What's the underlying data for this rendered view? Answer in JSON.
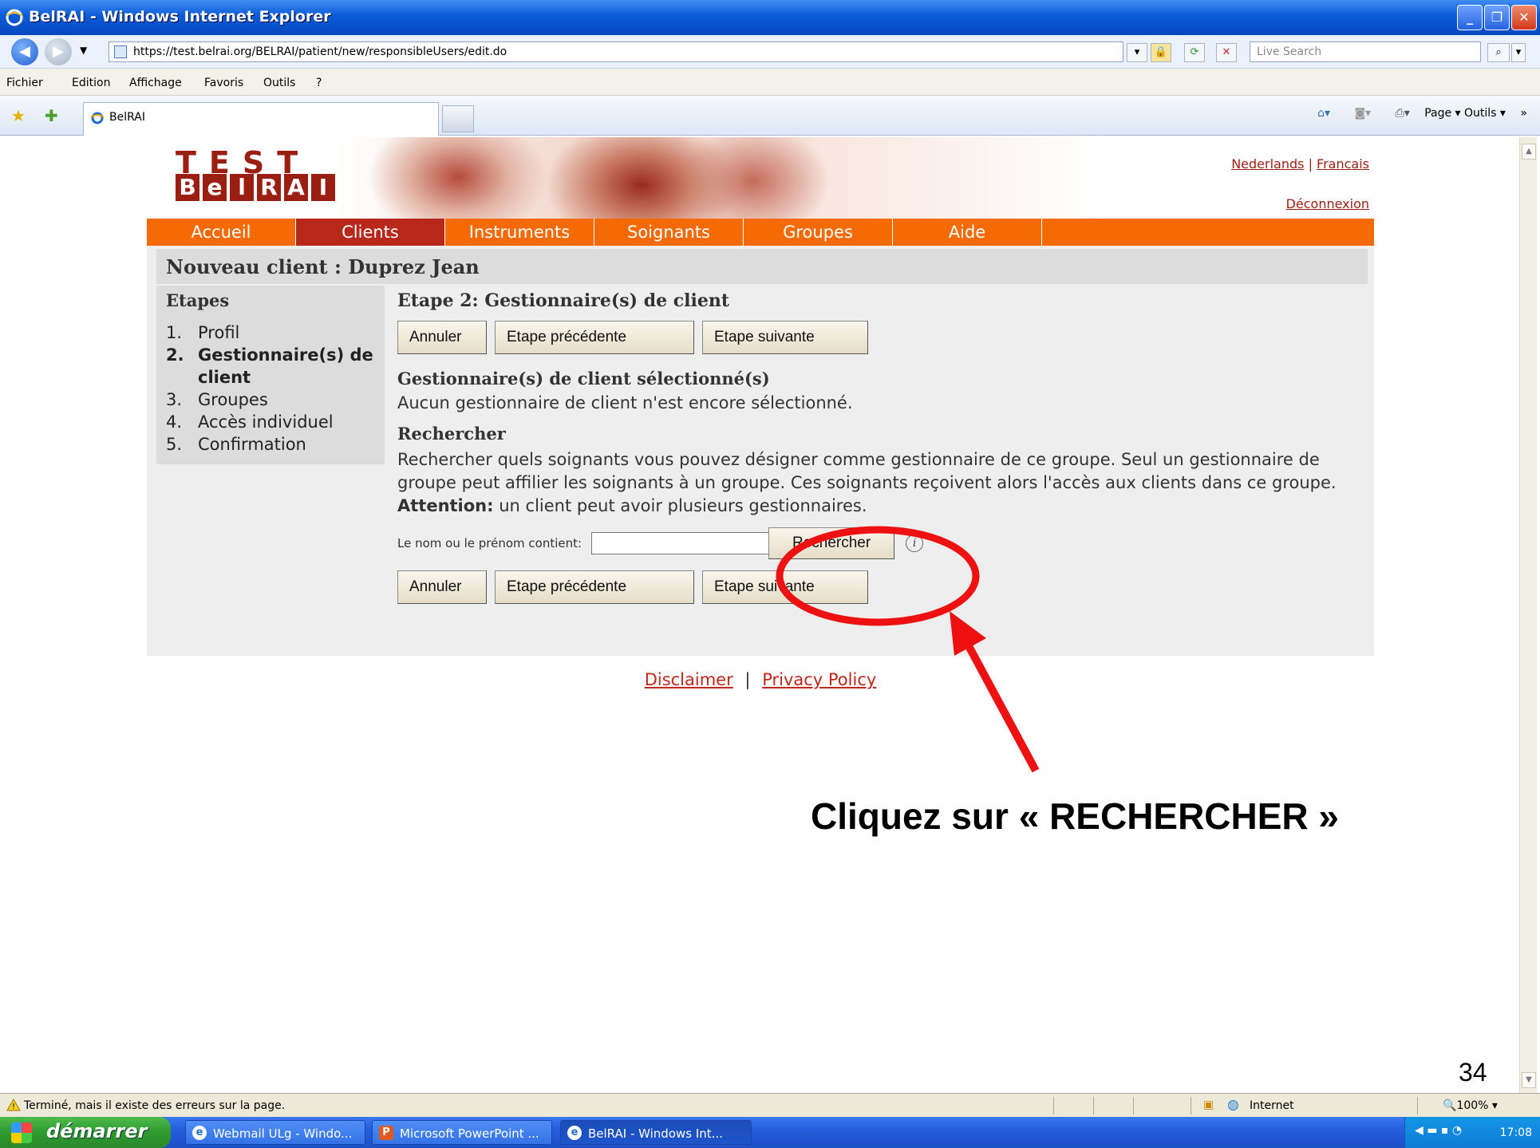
{
  "window": {
    "title": "BelRAI - Windows Internet Explorer",
    "minimize": "_",
    "maximize": "❐",
    "close": "✕"
  },
  "address": {
    "url": "https://test.belrai.org/BELRAI/patient/new/responsibleUsers/edit.do",
    "search_placeholder": "Live Search"
  },
  "menu": [
    "Fichier",
    "Edition",
    "Affichage",
    "Favoris",
    "Outils",
    "?"
  ],
  "tabs": {
    "active_label": "BelRAI",
    "command_bar": "Page ▾   Outils ▾"
  },
  "site": {
    "logo_top": "TEST",
    "logo_letters": [
      "B",
      "e",
      "l",
      "R",
      "A",
      "I"
    ],
    "lang": {
      "nl": "Nederlands",
      "sep": "|",
      "fr": "Francais"
    },
    "logout": "Déconnexion",
    "nav": [
      "Accueil",
      "Clients",
      "Instruments",
      "Soignants",
      "Groupes",
      "Aide"
    ],
    "active_nav": "Clients"
  },
  "page": {
    "client_title": "Nouveau client : Duprez Jean",
    "steps_title": "Etapes",
    "steps": [
      {
        "num": "1.",
        "label": "Profil"
      },
      {
        "num": "2.",
        "label": "Gestionnaire(s) de client"
      },
      {
        "num": "3.",
        "label": "Groupes"
      },
      {
        "num": "4.",
        "label": "Accès individuel"
      },
      {
        "num": "5.",
        "label": "Confirmation"
      }
    ],
    "step_heading": "Etape 2: Gestionnaire(s) de client",
    "buttons": {
      "cancel": "Annuler",
      "prev": "Etape précédente",
      "next": "Etape suivante"
    },
    "selected_heading": "Gestionnaire(s) de client sélectionné(s)",
    "selected_text": "Aucun gestionnaire de client n'est encore sélectionné.",
    "search_heading": "Rechercher",
    "search_desc_1": "Rechercher quels soignants vous pouvez désigner comme gestionnaire de ce groupe. Seul un gestionnaire de groupe peut affilier les soignants à un groupe. Ces soignants reçoivent alors l'accès aux clients dans ce groupe.",
    "search_desc_bold": "Attention:",
    "search_desc_2": "un client peut avoir plusieurs gestionnaires.",
    "search_label": "Le nom ou le prénom contient:",
    "search_value": "",
    "search_button": "Rechercher",
    "info_icon": "i"
  },
  "footer": {
    "disclaimer": "Disclaimer",
    "sep": "|",
    "privacy": "Privacy Policy"
  },
  "annotation": {
    "caption": "Cliquez sur « RECHERCHER »",
    "slide_number": "34",
    "color": "#ee1111"
  },
  "status": {
    "text": "Terminé, mais il existe des erreurs sur la page.",
    "zone": "Internet",
    "zoom": "100%"
  },
  "taskbar": {
    "start": "démarrer",
    "tasks": [
      {
        "label": "Webmail ULg - Windo...",
        "icon": "e"
      },
      {
        "label": "Microsoft PowerPoint ...",
        "icon": "P"
      },
      {
        "label": "BelRAI - Windows Int...",
        "icon": "e"
      }
    ],
    "clock": "17:08"
  },
  "colors": {
    "brand_red": "#9b1e12",
    "nav_orange": "#f66a05",
    "nav_active": "#b7281a"
  }
}
